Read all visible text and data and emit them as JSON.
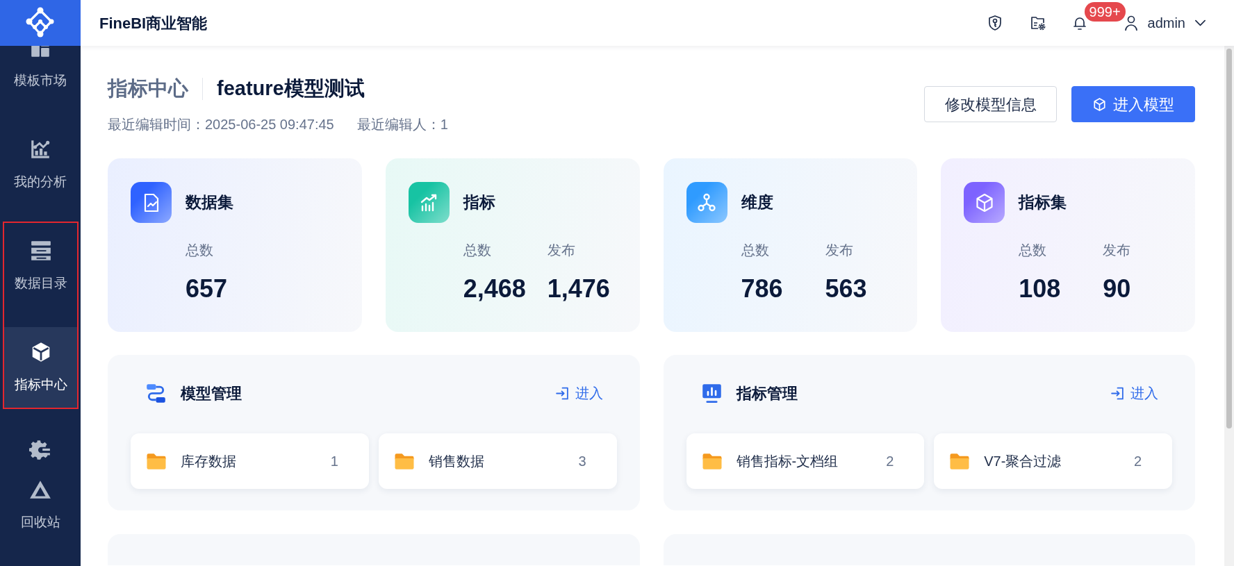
{
  "sidebar": {
    "items": [
      {
        "kind": "nav",
        "label": "模板市场",
        "selected": false,
        "highlighted": false
      },
      {
        "kind": "nav",
        "label": "我的分析",
        "selected": false,
        "highlighted": false
      },
      {
        "kind": "nav",
        "label": "数据目录",
        "selected": false,
        "highlighted": true
      },
      {
        "kind": "nav",
        "label": "指标中心",
        "selected": true,
        "highlighted": true
      },
      {
        "kind": "icon_only",
        "selected": false,
        "highlighted": false
      },
      {
        "kind": "nav",
        "label": "回收站",
        "selected": false,
        "highlighted": false
      }
    ]
  },
  "header": {
    "title": "FineBI商业智能",
    "notification_badge": "999+",
    "user": "admin"
  },
  "page_header": {
    "section": "指标中心",
    "title": "feature模型测试",
    "meta": [
      "最近编辑时间：2025-06-25 09:47:45",
      "最近编辑人：1"
    ],
    "buttons": [
      {
        "kind": "outline",
        "label": "修改模型信息"
      },
      {
        "kind": "primary",
        "label": "进入模型"
      }
    ]
  },
  "stat_cards": [
    {
      "title": "数据集",
      "color": "#2f62ff",
      "stats": [
        {
          "label": "总数",
          "value": "657"
        }
      ]
    },
    {
      "title": "指标",
      "color": "#17c3a3",
      "stats": [
        {
          "label": "总数",
          "value": "2,468"
        },
        {
          "label": "发布",
          "value": "1,476"
        }
      ]
    },
    {
      "title": "维度",
      "color": "#2f9bff",
      "stats": [
        {
          "label": "总数",
          "value": "786"
        },
        {
          "label": "发布",
          "value": "563"
        }
      ]
    },
    {
      "title": "指标集",
      "color": "#7d63ff",
      "stats": [
        {
          "label": "总数",
          "value": "108"
        },
        {
          "label": "发布",
          "value": "90"
        }
      ]
    }
  ],
  "panels": [
    {
      "kind": "full",
      "title": "模型管理",
      "link": "进入",
      "folders": [
        {
          "name": "库存数据",
          "count": "1"
        },
        {
          "name": "销售数据",
          "count": "3"
        }
      ]
    },
    {
      "kind": "full",
      "title": "指标管理",
      "link": "进入",
      "folders": [
        {
          "name": "销售指标-文档组",
          "count": "2"
        },
        {
          "name": "V7-聚合过滤",
          "count": "2"
        }
      ]
    },
    {
      "kind": "cut_off"
    },
    {
      "kind": "cut_off"
    }
  ]
}
